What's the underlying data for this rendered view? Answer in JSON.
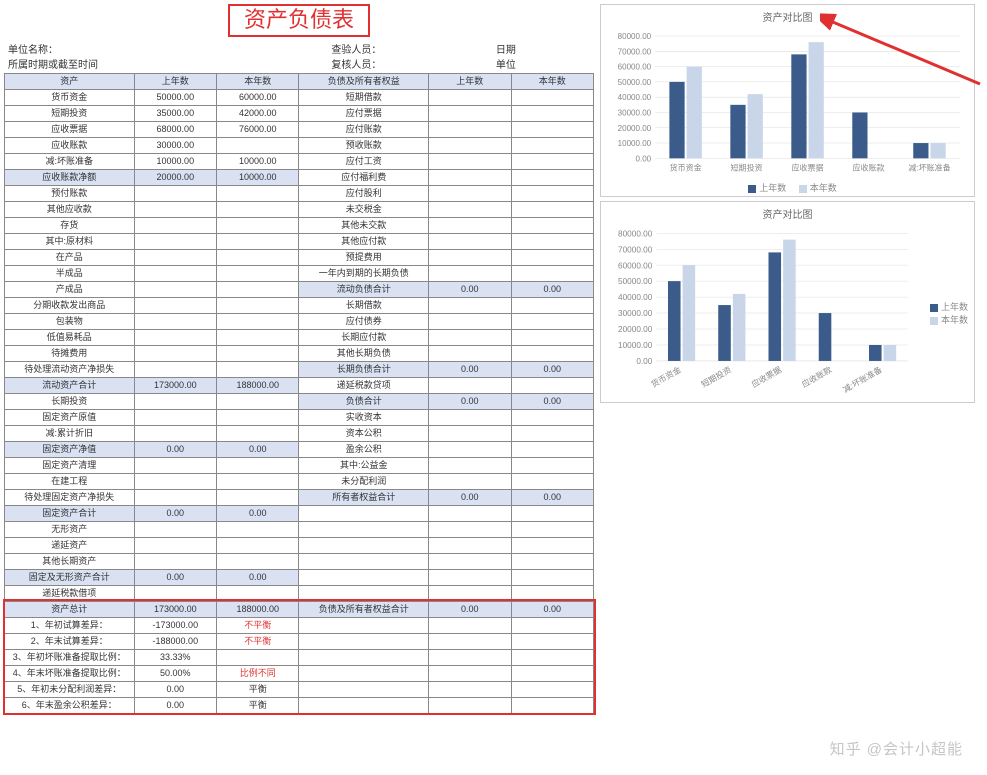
{
  "title": "资产负债表",
  "info_labels": {
    "unit_name": "单位名称：",
    "period": "所属时期或截至时间",
    "checker": "查验人员：",
    "reviewer": "复核人员：",
    "date": "日期",
    "unit": "单位"
  },
  "col_headers": {
    "asset": "资产",
    "prev": "上年数",
    "curr": "本年数",
    "liab": "负债及所有者权益",
    "prev2": "上年数",
    "curr2": "本年数"
  },
  "rows": [
    {
      "a": "货币资金",
      "p": "50000.00",
      "c": "60000.00",
      "l": "短期借款",
      "p2": "",
      "c2": ""
    },
    {
      "a": "短期投资",
      "p": "35000.00",
      "c": "42000.00",
      "l": "应付票据",
      "p2": "",
      "c2": ""
    },
    {
      "a": "应收票据",
      "p": "68000.00",
      "c": "76000.00",
      "l": "应付账款",
      "p2": "",
      "c2": ""
    },
    {
      "a": "应收账款",
      "p": "30000.00",
      "c": "",
      "l": "预收账款",
      "p2": "",
      "c2": ""
    },
    {
      "a": "减:坏账准备",
      "p": "10000.00",
      "c": "10000.00",
      "l": "应付工资",
      "p2": "",
      "c2": ""
    },
    {
      "a": "应收账款净额",
      "p": "20000.00",
      "c": "10000.00",
      "l": "应付福利费",
      "p2": "",
      "c2": "",
      "head": true
    },
    {
      "a": "预付账款",
      "p": "",
      "c": "",
      "l": "应付股利",
      "p2": "",
      "c2": ""
    },
    {
      "a": "其他应收款",
      "p": "",
      "c": "",
      "l": "未交税金",
      "p2": "",
      "c2": ""
    },
    {
      "a": "存货",
      "p": "",
      "c": "",
      "l": "其他未交款",
      "p2": "",
      "c2": ""
    },
    {
      "a": "其中:原材料",
      "p": "",
      "c": "",
      "l": "其他应付款",
      "p2": "",
      "c2": ""
    },
    {
      "a": "在产品",
      "p": "",
      "c": "",
      "l": "预提费用",
      "p2": "",
      "c2": ""
    },
    {
      "a": "半成品",
      "p": "",
      "c": "",
      "l": "一年内到期的长期负债",
      "p2": "",
      "c2": ""
    },
    {
      "a": "产成品",
      "p": "",
      "c": "",
      "l": "流动负债合计",
      "p2": "0.00",
      "c2": "0.00",
      "rhead": true
    },
    {
      "a": "分期收款发出商品",
      "p": "",
      "c": "",
      "l": "长期借款",
      "p2": "",
      "c2": ""
    },
    {
      "a": "包装物",
      "p": "",
      "c": "",
      "l": "应付债券",
      "p2": "",
      "c2": ""
    },
    {
      "a": "低值易耗品",
      "p": "",
      "c": "",
      "l": "长期应付款",
      "p2": "",
      "c2": ""
    },
    {
      "a": "待摊费用",
      "p": "",
      "c": "",
      "l": "其他长期负债",
      "p2": "",
      "c2": ""
    },
    {
      "a": "待处理流动资产净损失",
      "p": "",
      "c": "",
      "l": "长期负债合计",
      "p2": "0.00",
      "c2": "0.00",
      "rhead": true
    },
    {
      "a": "流动资产合计",
      "p": "173000.00",
      "c": "188000.00",
      "l": "递延税款贷项",
      "p2": "",
      "c2": "",
      "head": true
    },
    {
      "a": "长期投资",
      "p": "",
      "c": "",
      "l": "负债合计",
      "p2": "0.00",
      "c2": "0.00",
      "rhead": true
    },
    {
      "a": "固定资产原值",
      "p": "",
      "c": "",
      "l": "实收资本",
      "p2": "",
      "c2": ""
    },
    {
      "a": "减:累计折旧",
      "p": "",
      "c": "",
      "l": "资本公积",
      "p2": "",
      "c2": ""
    },
    {
      "a": "固定资产净值",
      "p": "0.00",
      "c": "0.00",
      "l": "盈余公积",
      "p2": "",
      "c2": "",
      "head": true
    },
    {
      "a": "固定资产清理",
      "p": "",
      "c": "",
      "l": "其中:公益金",
      "p2": "",
      "c2": ""
    },
    {
      "a": "在建工程",
      "p": "",
      "c": "",
      "l": "未分配利润",
      "p2": "",
      "c2": ""
    },
    {
      "a": "待处理固定资产净损失",
      "p": "",
      "c": "",
      "l": "所有者权益合计",
      "p2": "0.00",
      "c2": "0.00",
      "rhead": true
    },
    {
      "a": "固定资产合计",
      "p": "0.00",
      "c": "0.00",
      "l": "",
      "p2": "",
      "c2": "",
      "head": true
    },
    {
      "a": "无形资产",
      "p": "",
      "c": "",
      "l": "",
      "p2": "",
      "c2": ""
    },
    {
      "a": "递延资产",
      "p": "",
      "c": "",
      "l": "",
      "p2": "",
      "c2": ""
    },
    {
      "a": "其他长期资产",
      "p": "",
      "c": "",
      "l": "",
      "p2": "",
      "c2": ""
    },
    {
      "a": "固定及无形资产合计",
      "p": "0.00",
      "c": "0.00",
      "l": "",
      "p2": "",
      "c2": "",
      "head": true
    },
    {
      "a": "递延税款借项",
      "p": "",
      "c": "",
      "l": "",
      "p2": "",
      "c2": ""
    }
  ],
  "total_row": {
    "a": "资产总计",
    "p": "173000.00",
    "c": "188000.00",
    "l": "负债及所有者权益合计",
    "p2": "0.00",
    "c2": "0.00"
  },
  "check_rows": [
    {
      "label": "1、年初试算差异：",
      "v1": "-173000.00",
      "v2": "不平衡",
      "red": true
    },
    {
      "label": "2、年末试算差异：",
      "v1": "-188000.00",
      "v2": "不平衡",
      "red": true
    },
    {
      "label": "3、年初坏账准备提取比例：",
      "v1": "33.33%",
      "v2": ""
    },
    {
      "label": "4、年末坏账准备提取比例：",
      "v1": "50.00%",
      "v2": "比例不同",
      "red": true
    },
    {
      "label": "5、年初未分配利润差异：",
      "v1": "0.00",
      "v2": "平衡"
    },
    {
      "label": "6、年末盈余公积差异：",
      "v1": "0.00",
      "v2": "平衡"
    }
  ],
  "chart_data": [
    {
      "type": "bar",
      "title": "资产对比图",
      "categories": [
        "货币资金",
        "短期投资",
        "应收票据",
        "应收账款",
        "减:坏账准备"
      ],
      "series": [
        {
          "name": "上年数",
          "values": [
            50000,
            35000,
            68000,
            30000,
            10000
          ]
        },
        {
          "name": "本年数",
          "values": [
            60000,
            42000,
            76000,
            0,
            10000
          ]
        }
      ],
      "ylim": [
        0,
        80000
      ],
      "ystep": 10000,
      "legend_pos": "bottom"
    },
    {
      "type": "bar",
      "title": "资产对比图",
      "categories": [
        "货币资金",
        "短期投资",
        "应收票据",
        "应收账款",
        "减:坏账准备"
      ],
      "series": [
        {
          "name": "上年数",
          "values": [
            50000,
            35000,
            68000,
            30000,
            10000
          ]
        },
        {
          "name": "本年数",
          "values": [
            60000,
            42000,
            76000,
            0,
            10000
          ]
        }
      ],
      "ylim": [
        0,
        80000
      ],
      "ystep": 10000,
      "legend_pos": "right",
      "rotated_labels": true
    }
  ],
  "legend_labels": {
    "a": "上年数",
    "b": "本年数"
  },
  "watermark": "知乎 @会计小超能"
}
